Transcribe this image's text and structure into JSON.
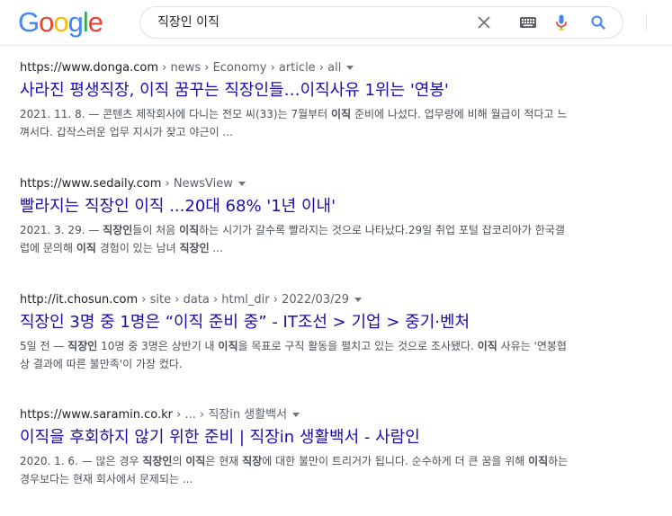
{
  "logo": {
    "letters": [
      "G",
      "o",
      "o",
      "g",
      "l",
      "e"
    ],
    "colors": [
      "#4285f4",
      "#ea4335",
      "#fbbc05",
      "#4285f4",
      "#34a853",
      "#ea4335"
    ]
  },
  "search": {
    "query": "직장인 이직"
  },
  "icons": {
    "clear": "close-icon",
    "keyboard": "keyboard-icon",
    "voice": "microphone-icon",
    "search": "search-icon"
  },
  "results": [
    {
      "domain": "https://www.donga.com",
      "path": " › news › Economy › article › all",
      "title": "사라진 평생직장, 이직 꿈꾸는 직장인들…이직사유 1위는 '연봉'",
      "snippet": [
        [
          "2021. 11. 8. — 콘텐츠 제작회사에 다니는 전모 씨(33)는 7월부터 ",
          false
        ],
        [
          "이직",
          true
        ],
        [
          " 준비에 나섰다. 업무량에 비해 월급이 적다고 느껴서다. 갑작스러운 업무 지시가 잦고 야근이 ...",
          false
        ]
      ]
    },
    {
      "domain": "https://www.sedaily.com",
      "path": " › NewsView",
      "title": "빨라지는 직장인 이직 ...20대 68% '1년 이내'",
      "snippet": [
        [
          "2021. 3. 29. — ",
          false
        ],
        [
          "직장인",
          true
        ],
        [
          "들이 처음 ",
          false
        ],
        [
          "이직",
          true
        ],
        [
          "하는 시기가 갈수록 빨라지는 것으로 나타났다.29일 취업 포털 잡코리아가 한국갤럽에 문의해 ",
          false
        ],
        [
          "이직",
          true
        ],
        [
          " 경험이 있는 남녀 ",
          false
        ],
        [
          "직장인",
          true
        ],
        [
          " ...",
          false
        ]
      ]
    },
    {
      "domain": "http://it.chosun.com",
      "path": " › site › data › html_dir › 2022/03/29",
      "title": "직장인 3명 중 1명은 “이직 준비 중” - IT조선 > 기업 > 중기·벤처",
      "snippet": [
        [
          "5일 전 — ",
          false
        ],
        [
          "직장인",
          true
        ],
        [
          " 10명 중 3명은 상반기 내 ",
          false
        ],
        [
          "이직",
          true
        ],
        [
          "을 목표로 구직 활동을 펼치고 있는 것으로 조사됐다. ",
          false
        ],
        [
          "이직",
          true
        ],
        [
          " 사유는 '연봉협상 결과에 따른 불만족'이 가장 컸다.",
          false
        ]
      ]
    },
    {
      "domain": "https://www.saramin.co.kr",
      "path": " › ... › 직장in 생활백서",
      "title": "이직을 후회하지 않기 위한 준비 | 직장in 생활백서 - 사람인",
      "snippet": [
        [
          "2020. 1. 6. — 많은 경우 ",
          false
        ],
        [
          "직장인",
          true
        ],
        [
          "의 ",
          false
        ],
        [
          "이직",
          true
        ],
        [
          "은 현재 ",
          false
        ],
        [
          "직장",
          true
        ],
        [
          "에 대한 불만이 트리거가 됩니다. 순수하게 더 큰 꿈을 위해 ",
          false
        ],
        [
          "이직",
          true
        ],
        [
          "하는 경우보다는 현재 회사에서 문제되는 ...",
          false
        ]
      ]
    }
  ]
}
